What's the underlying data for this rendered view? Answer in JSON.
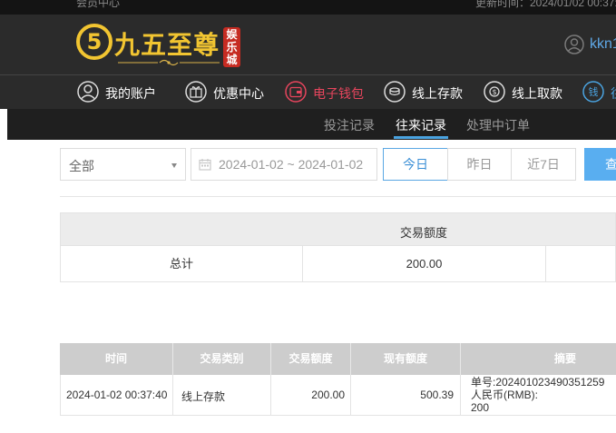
{
  "topbar": {
    "left_text": "会员中心",
    "right_text": "更新时间：2024/01/02 00:37:"
  },
  "brand": {
    "badge_text": "5",
    "title": "九五至尊",
    "seal_text": "娱乐城",
    "colors": {
      "gold": "#f2c531",
      "seal": "#c62b22"
    }
  },
  "user": {
    "icon": "user-circle-icon",
    "name": "kkn1"
  },
  "main_nav": {
    "items": [
      {
        "label": "我的账户",
        "icon": "account-icon",
        "active": false
      },
      {
        "label": "优惠中心",
        "icon": "gift-icon",
        "active": false
      },
      {
        "label": "电子钱包",
        "icon": "wallet-icon",
        "active": true
      },
      {
        "label": "线上存款",
        "icon": "deposit-icon",
        "active": false
      },
      {
        "label": "线上取款",
        "icon": "withdraw-icon",
        "active": false
      },
      {
        "label": "往",
        "icon": "records-icon",
        "active": false
      }
    ]
  },
  "sub_nav": {
    "tabs": [
      {
        "label": "投注记录",
        "active": false
      },
      {
        "label": "往来记录",
        "active": true
      },
      {
        "label": "处理中订单",
        "active": false
      }
    ]
  },
  "filters": {
    "type_select": "全部",
    "date_range": "2024-01-02 ~ 2024-01-02",
    "quick_ranges": [
      "今日",
      "昨日",
      "近7日"
    ],
    "active_range": "今日",
    "query_button": "查"
  },
  "summary": {
    "header": "交易额度",
    "total_label": "总计",
    "total_value": "200.00"
  },
  "transactions": {
    "columns": [
      "时间",
      "交易类别",
      "交易额度",
      "现有额度",
      "摘要"
    ],
    "rows": [
      {
        "time": "2024-01-02 00:37:40",
        "type": "线上存款",
        "amount": "200.00",
        "balance": "500.39",
        "memo_line1": "单号:202401023490351259",
        "memo_line2": "人民币(RMB):",
        "memo_line3": "200"
      }
    ]
  }
}
